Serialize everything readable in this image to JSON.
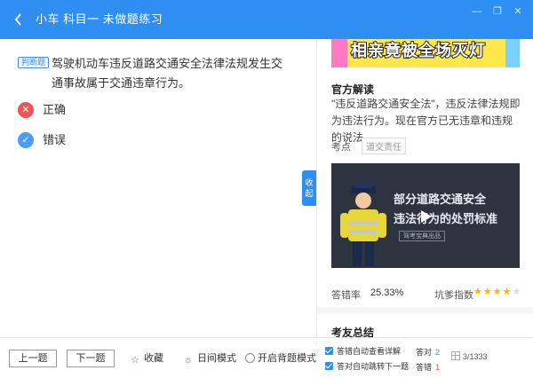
{
  "window": {
    "back_icon": "chevron-left-icon",
    "title": "小车  科目一  未做题练习",
    "minimize": "—",
    "maximize": "❐",
    "close": "✕"
  },
  "question": {
    "type_badge": "判断题",
    "text": "驾驶机动车违反道路交通安全法律法规发生交通事故属于交通违章行为。",
    "options": [
      {
        "icon": "close-icon",
        "symbol": "✕",
        "label": "正确",
        "color": "#f05555"
      },
      {
        "icon": "check-icon",
        "symbol": "✓",
        "label": "错误",
        "color": "#4a9ef5"
      }
    ]
  },
  "side_tab": {
    "label": "收起"
  },
  "panel": {
    "banner_text": "相亲竟被全场灭灯",
    "explanation_title": "官方解读",
    "explanation": "\"违反道路交通安全法\"，违反法律法规即为违法行为。现在官方已无违章和违规的说法。",
    "kp_label": "考点",
    "kp_tag": "道交责任",
    "video": {
      "line1": "部分道路交通安全",
      "line2": "违法行为的处罚标准",
      "source": "驾考宝典出品"
    },
    "accuracy_label": "答错率",
    "accuracy_value": "25.33%",
    "difficulty_label": "坑爹指数",
    "difficulty_stars": 4,
    "difficulty_max": 5,
    "next_section_title": "考友总结"
  },
  "bottom": {
    "prev": "上一题",
    "next": "下一题",
    "favorite": "收藏",
    "favorite_icon": "star-icon",
    "day_mode": "日间模式",
    "day_icon": "sun-icon",
    "memorize_mode": "开启背题模式",
    "auto_detail": "答错自动查看详解",
    "auto_next": "答对自动跳转下一题",
    "correct_label": "答对",
    "correct_count": "2",
    "correct_color": "#2f8ef2",
    "wrong_label": "答错",
    "wrong_count": "1",
    "wrong_color": "#f05555",
    "progress": "3/1333"
  }
}
